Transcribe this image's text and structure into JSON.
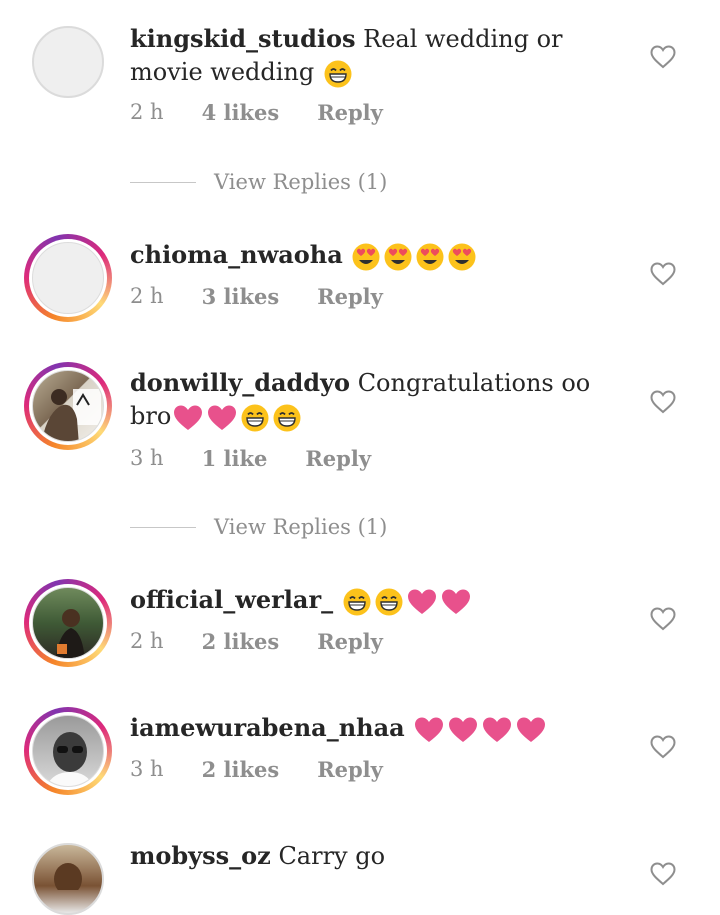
{
  "comments": [
    {
      "username": "kingskid_studios",
      "text": "Real wedding or movie wedding",
      "emojis": [
        "grin"
      ],
      "time": "2 h",
      "likes": "4 likes",
      "reply": "Reply",
      "replies_link": "View Replies (1)"
    },
    {
      "username": "chioma_nwaoha",
      "text": "",
      "emojis": [
        "heart-eyes",
        "heart-eyes",
        "heart-eyes",
        "heart-eyes"
      ],
      "time": "2 h",
      "likes": "3 likes",
      "reply": "Reply"
    },
    {
      "username": "donwilly_daddyo",
      "text": "Congratulations oo bro",
      "emojis": [
        "heart",
        "heart",
        "grin",
        "grin"
      ],
      "time": "3 h",
      "likes": "1 like",
      "reply": "Reply",
      "replies_link": "View Replies (1)"
    },
    {
      "username": "official_werlar_",
      "text": "",
      "emojis": [
        "grin",
        "grin",
        "heart",
        "heart"
      ],
      "time": "2 h",
      "likes": "2 likes",
      "reply": "Reply"
    },
    {
      "username": "iamewurabena_nhaa",
      "text": "",
      "emojis": [
        "heart",
        "heart",
        "heart",
        "heart"
      ],
      "time": "3 h",
      "likes": "2 likes",
      "reply": "Reply"
    },
    {
      "username": "mobyss_oz",
      "text": "Carry go",
      "emojis": []
    }
  ],
  "colors": {
    "heart_emoji": "#e8518c",
    "meta_gray": "#8e8e8e",
    "story_ring": "#dd2a7b"
  }
}
